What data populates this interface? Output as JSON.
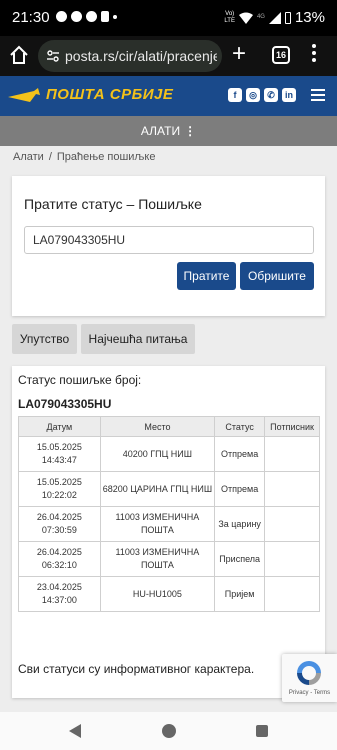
{
  "status_bar": {
    "time": "21:30",
    "network_label_top": "Vo)",
    "network_label_bottom": "LTE",
    "network_4g": "4G",
    "battery": "13%"
  },
  "browser": {
    "url": "posta.rs/cir/alati/pracenje-",
    "tab_count": "16"
  },
  "site": {
    "logo_text": "ПОШТА СРБИЈЕ",
    "social_icons": [
      "facebook-icon",
      "instagram-icon",
      "viber-icon",
      "linkedin-icon"
    ]
  },
  "toolsbar": {
    "label": "АЛАТИ"
  },
  "breadcrumb": {
    "root": "Алати",
    "separator": "/",
    "current": "Праћење пошиљке"
  },
  "track_form": {
    "title": "Пратите статус – Пошиљке",
    "input_value": "LA079043305HU",
    "track_button": "Пратите",
    "clear_button": "Обришите"
  },
  "tabs": {
    "instructions": "Упутство",
    "faq": "Најчешћа питања"
  },
  "results": {
    "status_label": "Статус пошиљке број:",
    "tracking_number": "LA079043305HU",
    "columns": [
      "Датум",
      "Место",
      "Статус",
      "Потписник"
    ],
    "rows": [
      {
        "date": "15.05.2025",
        "time": "14:43:47",
        "place": "40200 ГПЦ НИШ",
        "status": "Отпрема",
        "signer": ""
      },
      {
        "date": "15.05.2025",
        "time": "10:22:02",
        "place": "68200 ЦАРИНА ГПЦ НИШ",
        "status": "Отпрема",
        "signer": ""
      },
      {
        "date": "26.04.2025",
        "time": "07:30:59",
        "place": "11003 ИЗМЕНИЧНА ПОШТА",
        "status": "За царину",
        "signer": ""
      },
      {
        "date": "26.04.2025",
        "time": "06:32:10",
        "place": "11003 ИЗМЕНИЧНА ПОШТА",
        "status": "Приспела",
        "signer": ""
      },
      {
        "date": "23.04.2025",
        "time": "14:37:00",
        "place": "HU-HU1005",
        "status": "Пријем",
        "signer": ""
      }
    ],
    "note": "Сви статуси су информативног карактера."
  },
  "recaptcha": {
    "terms": "Privacy - Terms"
  },
  "colors": {
    "brand_blue": "#1a4a8b",
    "brand_yellow": "#f4c21a",
    "tools_gray": "#7d7d7d"
  }
}
